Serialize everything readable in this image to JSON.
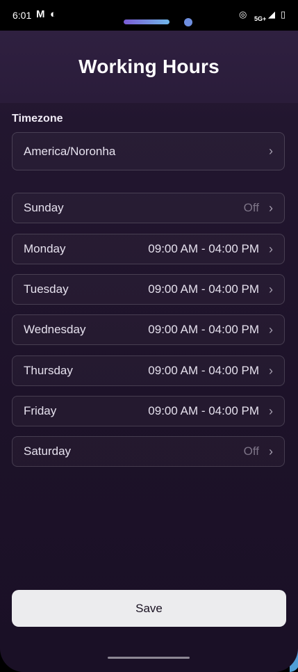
{
  "status_bar": {
    "time": "6:01",
    "network": "5G+"
  },
  "header": {
    "title": "Working Hours"
  },
  "timezone": {
    "label": "Timezone",
    "value": "America/Noronha"
  },
  "days": [
    {
      "day": "Sunday",
      "hours": "Off",
      "off": true
    },
    {
      "day": "Monday",
      "hours": "09:00 AM - 04:00 PM",
      "off": false
    },
    {
      "day": "Tuesday",
      "hours": "09:00 AM - 04:00 PM",
      "off": false
    },
    {
      "day": "Wednesday",
      "hours": "09:00 AM - 04:00 PM",
      "off": false
    },
    {
      "day": "Thursday",
      "hours": "09:00 AM - 04:00 PM",
      "off": false
    },
    {
      "day": "Friday",
      "hours": "09:00 AM - 04:00 PM",
      "off": false
    },
    {
      "day": "Saturday",
      "hours": "Off",
      "off": true
    }
  ],
  "save_label": "Save",
  "colors": {
    "background": "#1d1229",
    "header": "#2f2040",
    "save_button": "#ececee"
  }
}
